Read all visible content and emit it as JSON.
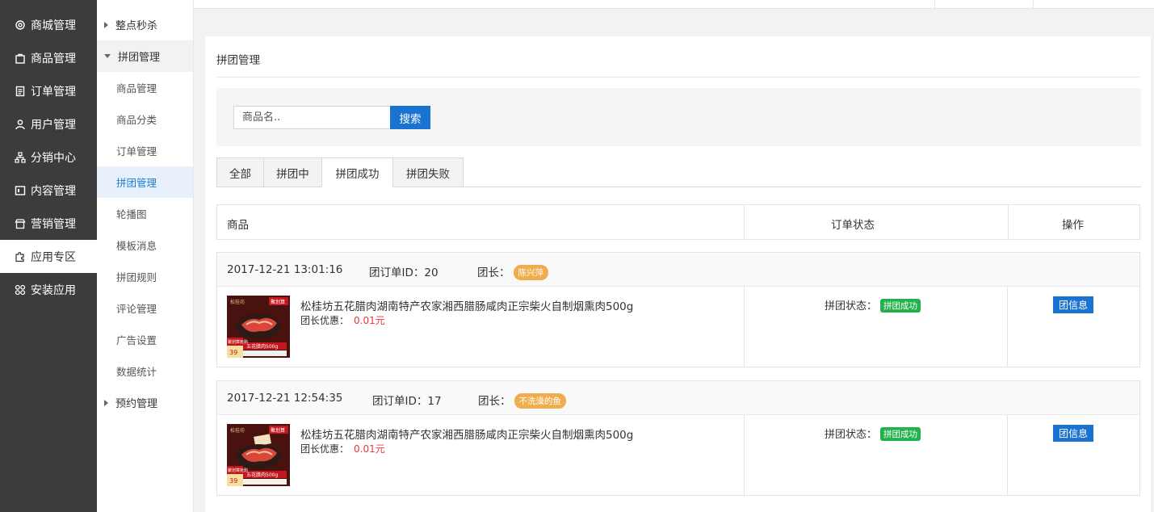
{
  "main_nav": [
    {
      "label": "商城管理",
      "icon": "gear-icon"
    },
    {
      "label": "商品管理",
      "icon": "bag-icon"
    },
    {
      "label": "订单管理",
      "icon": "document-icon"
    },
    {
      "label": "用户管理",
      "icon": "user-icon"
    },
    {
      "label": "分销中心",
      "icon": "hierarchy-icon"
    },
    {
      "label": "内容管理",
      "icon": "content-icon"
    },
    {
      "label": "营销管理",
      "icon": "store-icon"
    },
    {
      "label": "应用专区",
      "icon": "puzzle-icon",
      "active": true
    },
    {
      "label": "安装应用",
      "icon": "grid-icon"
    }
  ],
  "sub_nav": {
    "group1": "整点秒杀",
    "group2": "拼团管理",
    "items": [
      "商品管理",
      "商品分类",
      "订单管理",
      "拼团管理",
      "轮播图",
      "模板消息",
      "拼团规则",
      "评论管理",
      "广告设置",
      "数据统计"
    ],
    "group3": "预约管理"
  },
  "page": {
    "title": "拼团管理",
    "search_placeholder": "商品名..",
    "search_button": "搜索",
    "tabs": [
      "全部",
      "拼团中",
      "拼团成功",
      "拼团失败"
    ],
    "active_tab": "拼团成功"
  },
  "table": {
    "col_product": "商品",
    "col_status": "订单状态",
    "col_action": "操作"
  },
  "orders": [
    {
      "date": "2017-12-21 13:01:16",
      "group_id_label": "团订单ID：",
      "group_id": "20",
      "leader_label": "团长：",
      "leader": "陈兴萍",
      "product_name": "松桂坊五花腊肉湖南特产农家湘西腊肠咸肉正宗柴火自制烟熏肉500g",
      "discount_label": "团长优惠：",
      "discount": "0.01元",
      "status_label": "拼团状态：",
      "status": "拼团成功",
      "action": "团信息"
    },
    {
      "date": "2017-12-21 12:54:35",
      "group_id_label": "团订单ID：",
      "group_id": "17",
      "leader_label": "团长：",
      "leader": "不洗澡的鱼",
      "product_name": "松桂坊五花腊肉湖南特产农家湘西腊肠咸肉正宗柴火自制烟熏肉500g",
      "discount_label": "团长优惠：",
      "discount": "0.01元",
      "status_label": "拼团状态：",
      "status": "拼团成功",
      "action": "团信息"
    }
  ],
  "thumb": {
    "brand": "松桂坊",
    "tag": "聚划算",
    "banner": "五花腊肉500g",
    "price": "39",
    "promo": "聚划算抢购"
  },
  "colors": {
    "sidebar_bg": "#3c3c3c",
    "primary": "#1a73d1",
    "success": "#22b14c",
    "leader_badge": "#f0ad4e",
    "price": "#e23a3a"
  }
}
